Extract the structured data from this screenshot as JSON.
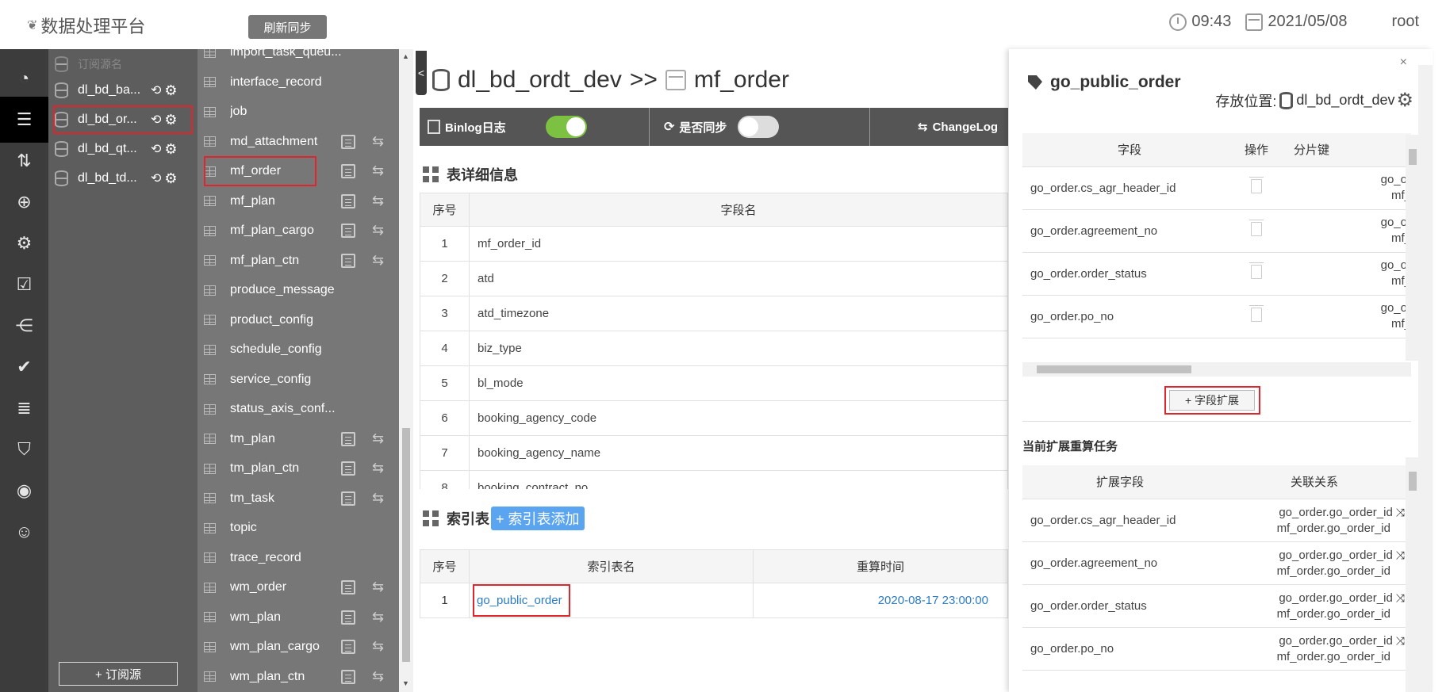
{
  "header": {
    "app_title": "数据处理平台",
    "refresh_btn": "刷新同步",
    "time": "09:43",
    "date": "2021/05/08",
    "user": "root"
  },
  "rail": {
    "icons": [
      "dashboard-icon",
      "database-icon",
      "sort-icon",
      "db-add-icon",
      "db-settings-icon",
      "task-list-icon",
      "flow-icon",
      "check-report-icon",
      "db-list-icon",
      "shield-icon",
      "eye-icon",
      "user-settings-icon"
    ],
    "active_index": 1
  },
  "sources": {
    "header": "订阅源名",
    "items": [
      "dl_bd_ba...",
      "dl_bd_or...",
      "dl_bd_qt...",
      "dl_bd_td..."
    ],
    "selected_index": 1,
    "subscribe_btn": "+ 订阅源"
  },
  "tables": {
    "items": [
      {
        "name": "import_task_queu...",
        "has_actions": false
      },
      {
        "name": "interface_record",
        "has_actions": false
      },
      {
        "name": "job",
        "has_actions": false
      },
      {
        "name": "md_attachment",
        "has_actions": true
      },
      {
        "name": "mf_order",
        "has_actions": true
      },
      {
        "name": "mf_plan",
        "has_actions": true
      },
      {
        "name": "mf_plan_cargo",
        "has_actions": true
      },
      {
        "name": "mf_plan_ctn",
        "has_actions": true
      },
      {
        "name": "produce_message",
        "has_actions": false
      },
      {
        "name": "product_config",
        "has_actions": false
      },
      {
        "name": "schedule_config",
        "has_actions": false
      },
      {
        "name": "service_config",
        "has_actions": false
      },
      {
        "name": "status_axis_conf...",
        "has_actions": false
      },
      {
        "name": "tm_plan",
        "has_actions": true
      },
      {
        "name": "tm_plan_ctn",
        "has_actions": true
      },
      {
        "name": "tm_task",
        "has_actions": true
      },
      {
        "name": "topic",
        "has_actions": false
      },
      {
        "name": "trace_record",
        "has_actions": false
      },
      {
        "name": "wm_order",
        "has_actions": true
      },
      {
        "name": "wm_plan",
        "has_actions": true
      },
      {
        "name": "wm_plan_cargo",
        "has_actions": true
      },
      {
        "name": "wm_plan_ctn",
        "has_actions": true
      }
    ],
    "selected_index": 4
  },
  "main": {
    "db_name": "dl_bd_ordt_dev",
    "sep": ">>",
    "table_name": "mf_order",
    "binlog_label": "Binlog日志",
    "binlog_on": true,
    "sync_label": "是否同步",
    "sync_on": false,
    "changelog_label": "ChangeLog",
    "detail_title": "表详细信息",
    "field_headers": [
      "序号",
      "字段名"
    ],
    "fields": [
      [
        "1",
        "mf_order_id"
      ],
      [
        "2",
        "atd"
      ],
      [
        "3",
        "atd_timezone"
      ],
      [
        "4",
        "biz_type"
      ],
      [
        "5",
        "bl_mode"
      ],
      [
        "6",
        "booking_agency_code"
      ],
      [
        "7",
        "booking_agency_name"
      ],
      [
        "8",
        "booking_contract_no"
      ]
    ],
    "index_title": "索引表",
    "index_add_btn": "+ 索引表添加",
    "index_headers": [
      "序号",
      "索引表名",
      "重算时间"
    ],
    "index_rows": [
      [
        "1",
        "go_public_order",
        "2020-08-17 23:00:00"
      ]
    ]
  },
  "right_panel": {
    "close": "×",
    "title": "go_public_order",
    "location_label": "存放位置:",
    "location_db": "dl_bd_ordt_dev",
    "field_headers": [
      "字段",
      "操作",
      "分片键"
    ],
    "fields": [
      {
        "field": "go_order.cs_agr_header_id",
        "shard": [
          "go_or",
          "mf_"
        ]
      },
      {
        "field": "go_order.agreement_no",
        "shard": [
          "go_or",
          "mf_"
        ]
      },
      {
        "field": "go_order.order_status",
        "shard": [
          "go_or",
          "mf_"
        ]
      },
      {
        "field": "go_order.po_no",
        "shard": [
          "go_or",
          "mf_"
        ]
      }
    ],
    "expand_btn": "+ 字段扩展",
    "task_title": "当前扩展重算任务",
    "task_headers": [
      "扩展字段",
      "关联关系"
    ],
    "tasks": [
      {
        "field": "go_order.cs_agr_header_id",
        "rel1": "go_order.go_order_id",
        "rel2": "mf_order.go_order_id"
      },
      {
        "field": "go_order.agreement_no",
        "rel1": "go_order.go_order_id",
        "rel2": "mf_order.go_order_id"
      },
      {
        "field": "go_order.order_status",
        "rel1": "go_order.go_order_id",
        "rel2": "mf_order.go_order_id"
      },
      {
        "field": "go_order.po_no",
        "rel1": "go_order.go_order_id",
        "rel2": "mf_order.go_order_id"
      }
    ]
  },
  "colors": {
    "accent_green": "#7dc143",
    "link": "#2b7cc4",
    "highlight_red": "#e0262d",
    "add_btn": "#5aa4f0"
  }
}
